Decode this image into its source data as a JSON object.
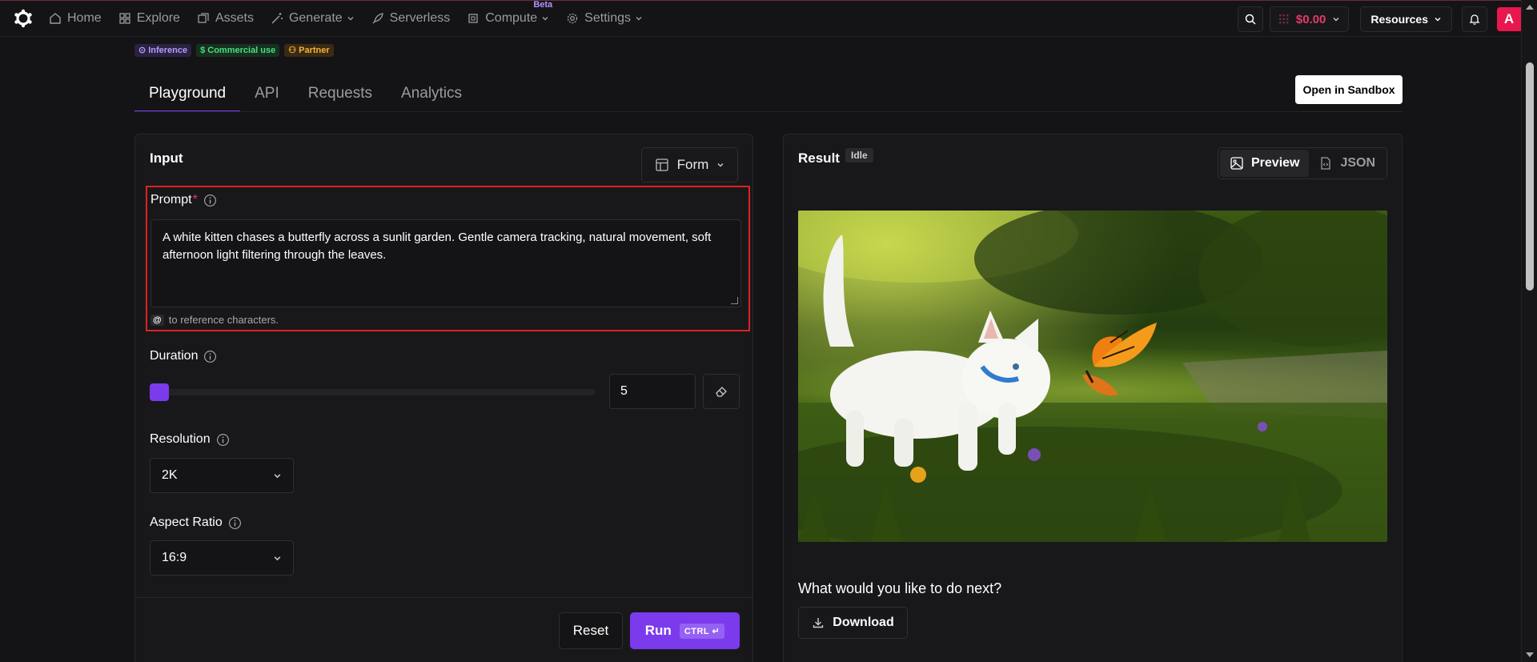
{
  "nav": {
    "home": "Home",
    "explore": "Explore",
    "assets": "Assets",
    "generate": "Generate",
    "serverless": "Serverless",
    "compute": "Compute",
    "compute_badge": "Beta",
    "settings": "Settings",
    "balance": "$0.00",
    "resources": "Resources",
    "avatar_letter": "A"
  },
  "badges": {
    "inference": "Inference",
    "commercial": "Commercial use",
    "partner": "Partner"
  },
  "tabs": [
    "Playground",
    "API",
    "Requests",
    "Analytics"
  ],
  "sandbox_button": "Open in Sandbox",
  "input": {
    "title": "Input",
    "mode": "Form",
    "prompt_label": "Prompt",
    "prompt_required": "*",
    "prompt_value": "A white kitten chases a butterfly across a sunlit garden. Gentle camera tracking, natural movement, soft afternoon light filtering through the leaves.",
    "hint_at": "@",
    "hint_text": "to reference characters.",
    "duration_label": "Duration",
    "duration_value": "5",
    "duration_slider_fraction": 0.0,
    "resolution_label": "Resolution",
    "resolution_value": "2K",
    "aspect_label": "Aspect Ratio",
    "aspect_value": "16:9",
    "reset": "Reset",
    "run": "Run",
    "run_shortcut": "CTRL ↵"
  },
  "result": {
    "title": "Result",
    "status": "Idle",
    "view_preview": "Preview",
    "view_json": "JSON",
    "next_question": "What would you like to do next?",
    "download": "Download"
  },
  "colors": {
    "accent": "#7c3aed",
    "danger": "#e23b67",
    "highlight_box": "#e02020"
  }
}
